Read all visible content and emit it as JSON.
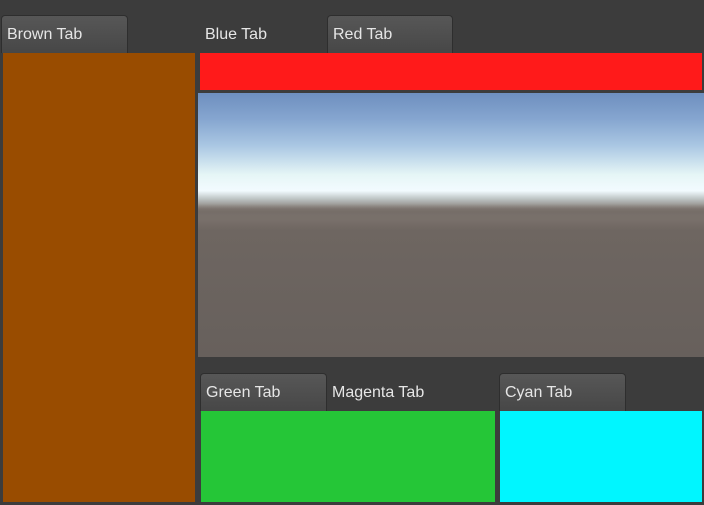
{
  "left_panel": {
    "tabs": [
      {
        "label": "Brown Tab"
      }
    ],
    "content_color": "#994c00"
  },
  "top_panel": {
    "tabs": [
      {
        "label": "Blue Tab"
      },
      {
        "label": "Red Tab"
      }
    ],
    "content_color": "#ff1a1a"
  },
  "bottom_left_panel": {
    "tabs": [
      {
        "label": "Green Tab"
      },
      {
        "label": "Magenta Tab"
      }
    ],
    "content_color": "#25c637"
  },
  "bottom_right_panel": {
    "tabs": [
      {
        "label": "Cyan Tab"
      }
    ],
    "content_color": "#00f6ff"
  },
  "scene_view": {
    "type": "3d-scene-preview"
  }
}
